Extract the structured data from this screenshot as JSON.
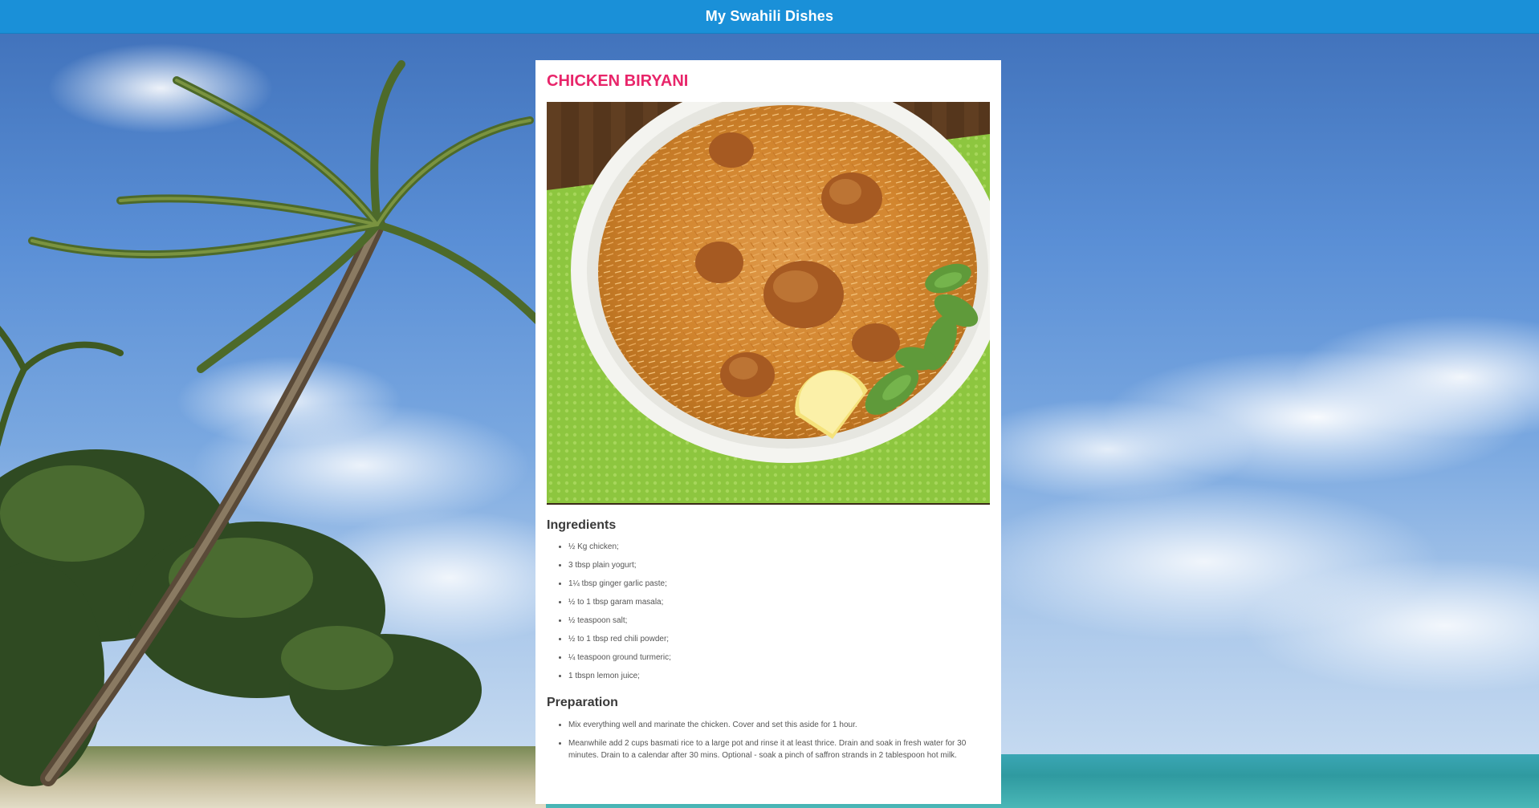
{
  "header": {
    "title": "My Swahili Dishes"
  },
  "recipe": {
    "title": "CHICKEN BIRYANI",
    "image_alt": "chicken-biryani-photo",
    "ingredients_heading": "Ingredients",
    "ingredients": [
      "½ Kg chicken;",
      "3 tbsp plain yogurt;",
      "1¼ tbsp ginger garlic paste;",
      "½ to 1 tbsp garam masala;",
      "½ teaspoon salt;",
      "½ to 1 tbsp red chili powder;",
      "¼ teaspoon ground turmeric;",
      "1 tbspn lemon juice;"
    ],
    "preparation_heading": "Preparation",
    "preparation": [
      "Mix everything well and marinate the chicken. Cover and set this aside for 1 hour.",
      "Meanwhile add 2 cups basmati rice to a large pot and rinse it at least thrice. Drain and soak in fresh water for 30 minutes. Drain to a calendar after 30 mins. Optional - soak a pinch of saffron strands in 2 tablespoon hot milk."
    ]
  },
  "colors": {
    "header_bg": "#1a90d8",
    "title_accent": "#e8256a"
  }
}
